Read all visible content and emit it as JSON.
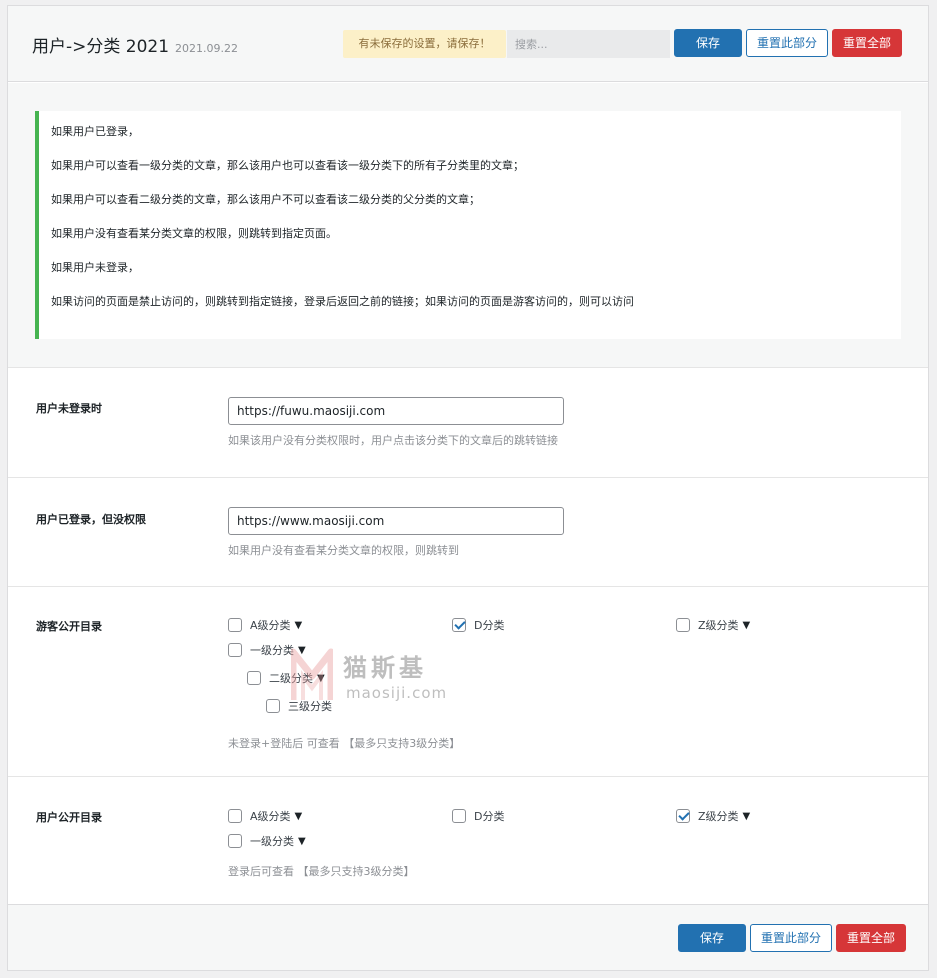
{
  "header": {
    "title": "用户->分类 2021",
    "version": "2021.09.22",
    "notice": "有未保存的设置，请保存！",
    "search_placeholder": "搜索...",
    "save_label": "保存",
    "reset_section_label": "重置此部分",
    "reset_all_label": "重置全部"
  },
  "info": {
    "lines": [
      "如果用户已登录，",
      "如果用户可以查看一级分类的文章，那么该用户也可以查看该一级分类下的所有子分类里的文章；",
      "如果用户可以查看二级分类的文章，那么该用户不可以查看该二级分类的父分类的文章；",
      "如果用户没有查看某分类文章的权限，则跳转到指定页面。",
      "如果用户未登录，",
      "如果访问的页面是禁止访问的，则跳转到指定链接，登录后返回之前的链接；如果访问的页面是游客访问的，则可以访问"
    ],
    "accent_color": "#46b450"
  },
  "not_logged_in": {
    "label": "用户未登录时",
    "value": "https://fuwu.maosiji.com",
    "description": "如果该用户没有分类权限时，用户点击该分类下的文章后的跳转链接"
  },
  "logged_in_no_permission": {
    "label": "用户已登录，但没权限",
    "value": "https://www.maosiji.com",
    "description": "如果用户没有查看某分类文章的权限，则跳转到"
  },
  "guest_public": {
    "label": "游客公开目录",
    "items": [
      {
        "label": "A级分类",
        "checked": false,
        "caret": "▼"
      },
      {
        "label": "D分类",
        "checked": true,
        "caret": ""
      },
      {
        "label": "Z级分类",
        "checked": false,
        "caret": "▼"
      },
      {
        "label": "一级分类",
        "checked": false,
        "caret": "▼"
      },
      {
        "label": "二级分类",
        "checked": false,
        "caret": "▼"
      },
      {
        "label": "三级分类",
        "checked": false,
        "caret": ""
      }
    ],
    "description": "未登录+登陆后 可查看 【最多只支持3级分类】"
  },
  "user_public": {
    "label": "用户公开目录",
    "items": [
      {
        "label": "A级分类",
        "checked": false,
        "caret": "▼"
      },
      {
        "label": "D分类",
        "checked": false,
        "caret": ""
      },
      {
        "label": "Z级分类",
        "checked": true,
        "caret": "▼"
      },
      {
        "label": "一级分类",
        "checked": false,
        "caret": "▼"
      }
    ],
    "description": "登录后可查看 【最多只支持3级分类】"
  },
  "watermark": {
    "name": "猫斯基",
    "url": "maosiji.com"
  },
  "footer": {
    "save_label": "保存",
    "reset_section_label": "重置此部分",
    "reset_all_label": "重置全部"
  },
  "colors": {
    "primary": "#2271b1",
    "danger": "#d63638",
    "notice_bg": "#fcf0c8"
  }
}
